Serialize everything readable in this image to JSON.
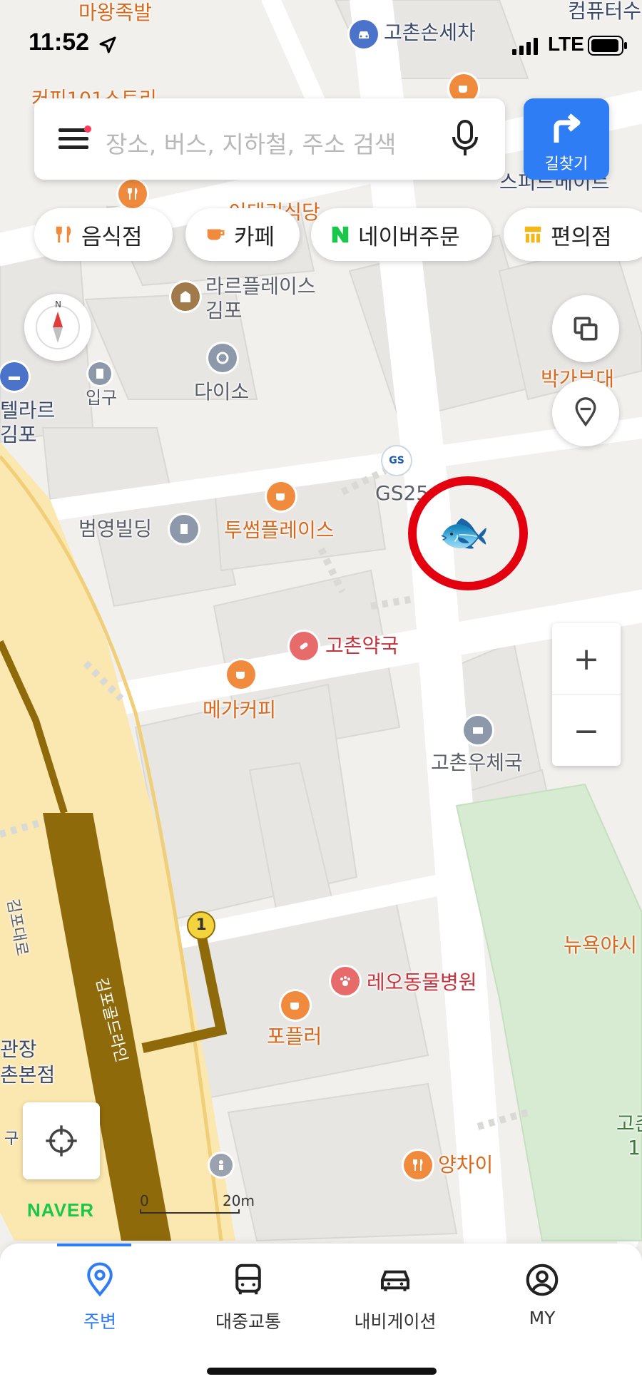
{
  "status_bar": {
    "time": "11:52",
    "network": "LTE"
  },
  "search": {
    "placeholder": "장소, 버스, 지하철, 주소 검색"
  },
  "route_button": {
    "label": "길찾기"
  },
  "chips": [
    {
      "label": "음식점",
      "icon": "fork-knife-icon"
    },
    {
      "label": "카페",
      "icon": "coffee-cup-icon"
    },
    {
      "label": "네이버주문",
      "icon": "naver-n-icon"
    },
    {
      "label": "편의점",
      "icon": "store-icon"
    }
  ],
  "map": {
    "labels": {
      "majokbal": "마왕족발",
      "gochon_wash": "고촌손세차",
      "computer": "컴퓨터수",
      "coffee101": "커피101스토리",
      "speed": "스피드메이트",
      "restaurant": "이태리식당",
      "larr1": "라르플레이스",
      "larr2": "김포",
      "entrance": "입구",
      "daiso": "다이소",
      "bakga": "박가부대",
      "tela1": "텔라르",
      "tela2": "김포",
      "gs25": "GS25",
      "beomyoung": "범영빌딩",
      "twosome": "투썸플레이스",
      "pharmacy": "고촌약국",
      "mega": "메가커피",
      "post": "고촌우체국",
      "gimpo_road": "김포대로",
      "gold_line": "김포골드라인",
      "station_num": "1",
      "gwanjang1": "관장",
      "gwanjang2": "촌본점",
      "gu": "구",
      "vet": "레오동물병원",
      "popler": "포플러",
      "yangchai": "양차이",
      "newyork": "뉴욕야시",
      "gochon_right": "고촌",
      "gochon_right2": "1"
    },
    "scale": {
      "zero": "0",
      "distance": "20m"
    },
    "logo": "NAVER",
    "highlight_marker": "fish-icon"
  },
  "zoom": {
    "plus": "+",
    "minus": "−"
  },
  "bottom_nav": [
    {
      "label": "주변",
      "icon": "location-pin-icon",
      "active": true
    },
    {
      "label": "대중교통",
      "icon": "bus-icon",
      "active": false
    },
    {
      "label": "내비게이션",
      "icon": "car-icon",
      "active": false
    },
    {
      "label": "MY",
      "icon": "user-icon",
      "active": false
    }
  ],
  "colors": {
    "accent": "#2f7df5",
    "highlight_ring": "#e3000f",
    "rail": "#8e6a0b",
    "green_area": "#d7ead2",
    "road_yellow": "#fbe7b0"
  }
}
